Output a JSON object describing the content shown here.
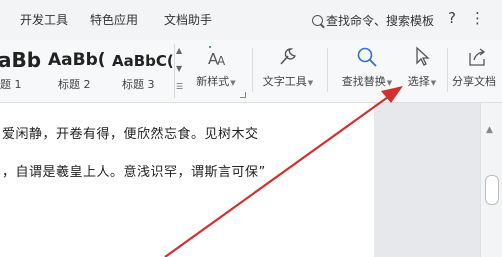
{
  "menu": {
    "items": [
      "开发工具",
      "特色应用",
      "文档助手"
    ],
    "search_text": "查找命令、搜索模板",
    "help_glyph": "?",
    "more_glyph": "⋮"
  },
  "styles": [
    {
      "sample": "aBb",
      "label": "题 1"
    },
    {
      "sample": "AaBb(",
      "label": "标题 2"
    },
    {
      "sample": "AaBbC(",
      "label": "标题 3"
    }
  ],
  "tools": {
    "new_style": "新样式",
    "text_tools": "文字工具",
    "find_replace": "查找替换",
    "select": "选择",
    "share": "分享文档"
  },
  "document": {
    "line1": "爱闲静，开卷有得，便欣然忘食。见树木交",
    "line2": "，自谓是羲皇上人。意浅识罕，谓斯言可保”"
  },
  "colors": {
    "arrow": "#d32f2f",
    "search_icon": "#2f6fd6",
    "newstyle_icon": "#3aa04a"
  }
}
